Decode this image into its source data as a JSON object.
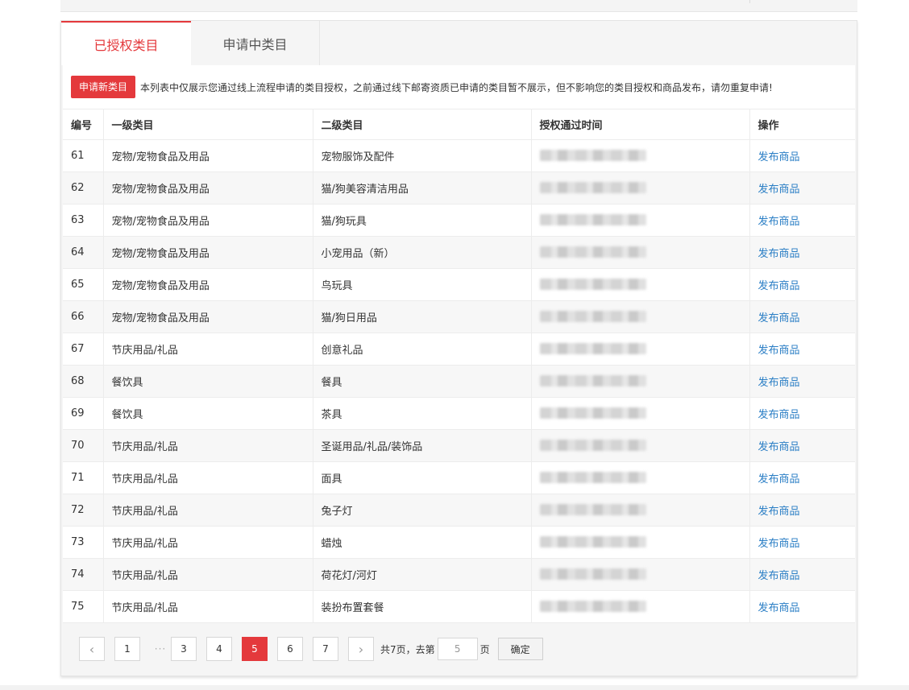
{
  "tabs": [
    {
      "label": "已授权类目",
      "active": true
    },
    {
      "label": "申请中类目",
      "active": false
    }
  ],
  "notice": {
    "button_label": "申请新类目",
    "text": "本列表中仅展示您通过线上流程申请的类目授权，之前通过线下邮寄资质已申请的类目暂不展示，但不影响您的类目授权和商品发布，请勿重复申请!"
  },
  "table": {
    "headers": [
      "编号",
      "一级类目",
      "二级类目",
      "授权通过时间",
      "操作"
    ],
    "rows": [
      {
        "id": "61",
        "cat1": "宠物/宠物食品及用品",
        "cat2": "宠物服饰及配件",
        "action": "发布商品"
      },
      {
        "id": "62",
        "cat1": "宠物/宠物食品及用品",
        "cat2": "猫/狗美容清洁用品",
        "action": "发布商品"
      },
      {
        "id": "63",
        "cat1": "宠物/宠物食品及用品",
        "cat2": "猫/狗玩具",
        "action": "发布商品"
      },
      {
        "id": "64",
        "cat1": "宠物/宠物食品及用品",
        "cat2": "小宠用品（新）",
        "action": "发布商品"
      },
      {
        "id": "65",
        "cat1": "宠物/宠物食品及用品",
        "cat2": "鸟玩具",
        "action": "发布商品"
      },
      {
        "id": "66",
        "cat1": "宠物/宠物食品及用品",
        "cat2": "猫/狗日用品",
        "action": "发布商品"
      },
      {
        "id": "67",
        "cat1": "节庆用品/礼品",
        "cat2": "创意礼品",
        "action": "发布商品"
      },
      {
        "id": "68",
        "cat1": "餐饮具",
        "cat2": "餐具",
        "action": "发布商品"
      },
      {
        "id": "69",
        "cat1": "餐饮具",
        "cat2": "茶具",
        "action": "发布商品"
      },
      {
        "id": "70",
        "cat1": "节庆用品/礼品",
        "cat2": "圣诞用品/礼品/装饰品",
        "action": "发布商品"
      },
      {
        "id": "71",
        "cat1": "节庆用品/礼品",
        "cat2": "面具",
        "action": "发布商品"
      },
      {
        "id": "72",
        "cat1": "节庆用品/礼品",
        "cat2": "兔子灯",
        "action": "发布商品"
      },
      {
        "id": "73",
        "cat1": "节庆用品/礼品",
        "cat2": "蜡烛",
        "action": "发布商品"
      },
      {
        "id": "74",
        "cat1": "节庆用品/礼品",
        "cat2": "荷花灯/河灯",
        "action": "发布商品"
      },
      {
        "id": "75",
        "cat1": "节庆用品/礼品",
        "cat2": "装扮布置套餐",
        "action": "发布商品"
      }
    ]
  },
  "pagination": {
    "prev_icon": "chevron-left-icon",
    "next_icon": "chevron-right-icon",
    "pages": [
      "1",
      "3",
      "4",
      "5",
      "6",
      "7"
    ],
    "ellipsis": "···",
    "current": "5",
    "total_text": "共7页，去第",
    "page_unit": "页",
    "input_value": "5",
    "confirm_label": "确定"
  },
  "colors": {
    "accent": "#e4393c",
    "link": "#2a7ec5"
  }
}
